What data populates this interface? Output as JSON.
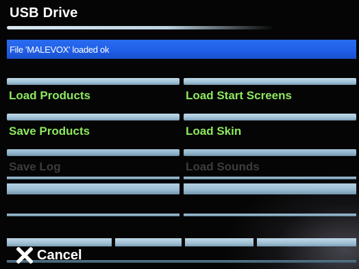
{
  "header": {
    "title": "USB Drive"
  },
  "status": {
    "message": "File 'MALEVOX' loaded ok",
    "color": "#2a6cf0"
  },
  "buttons": {
    "load_products": "Load Products",
    "load_start_screens": "Load Start Screens",
    "save_products": "Save Products",
    "load_skin": "Load Skin",
    "save_log": "Save Log",
    "load_sounds": "Load Sounds"
  },
  "footer": {
    "cancel_label": "Cancel",
    "cancel_icon": "close-icon"
  },
  "colors": {
    "enabled_label": "#8de85f",
    "disabled_label": "#3c3c3c",
    "bar": "#a3c4d8"
  }
}
